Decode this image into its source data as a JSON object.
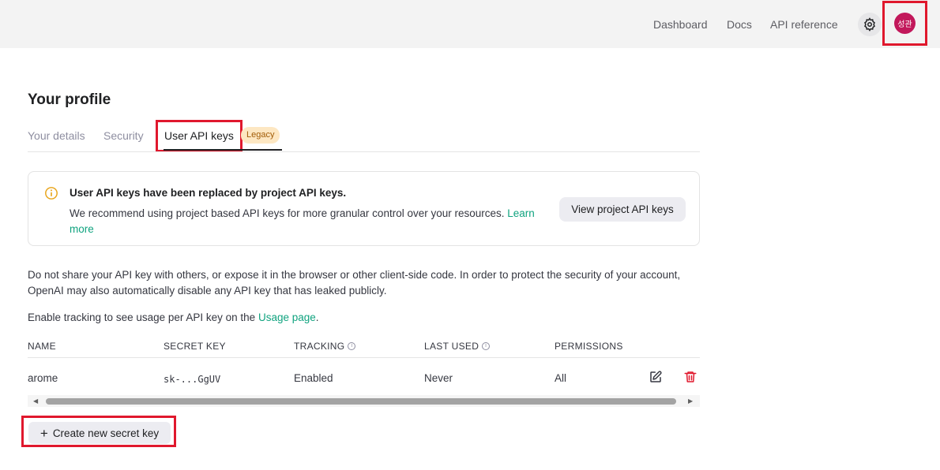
{
  "header": {
    "nav": [
      "Dashboard",
      "Docs",
      "API reference"
    ],
    "avatar_initials": "성관",
    "avatar_color": "#c2185b"
  },
  "page": {
    "title": "Your profile"
  },
  "tabs": {
    "items": [
      "Your details",
      "Security",
      "User API keys"
    ],
    "active": "User API keys",
    "legacy_badge": "Legacy"
  },
  "notice": {
    "title": "User API keys have been replaced by project API keys.",
    "body": "We recommend using project based API keys for more granular control over your resources.",
    "link_text": "Learn more",
    "button_label": "View project API keys"
  },
  "info": {
    "warning": "Do not share your API key with others, or expose it in the browser or other client-side code. In order to protect the security of your account, OpenAI may also automatically disable any API key that has leaked publicly.",
    "tracking_prefix": "Enable tracking to see usage per API key on the",
    "tracking_link": "Usage page",
    "tracking_suffix": "."
  },
  "table": {
    "headers": [
      "NAME",
      "SECRET KEY",
      "TRACKING",
      "LAST USED",
      "PERMISSIONS"
    ],
    "rows": [
      {
        "name": "arome",
        "secret_key": "sk-...GgUV",
        "tracking": "Enabled",
        "last_used": "Never",
        "permissions": "All"
      }
    ]
  },
  "create_button": "Create new secret key",
  "colors": {
    "accent_link": "#10a37f",
    "highlight_border": "#e0182d",
    "delete_icon": "#e0182d"
  }
}
